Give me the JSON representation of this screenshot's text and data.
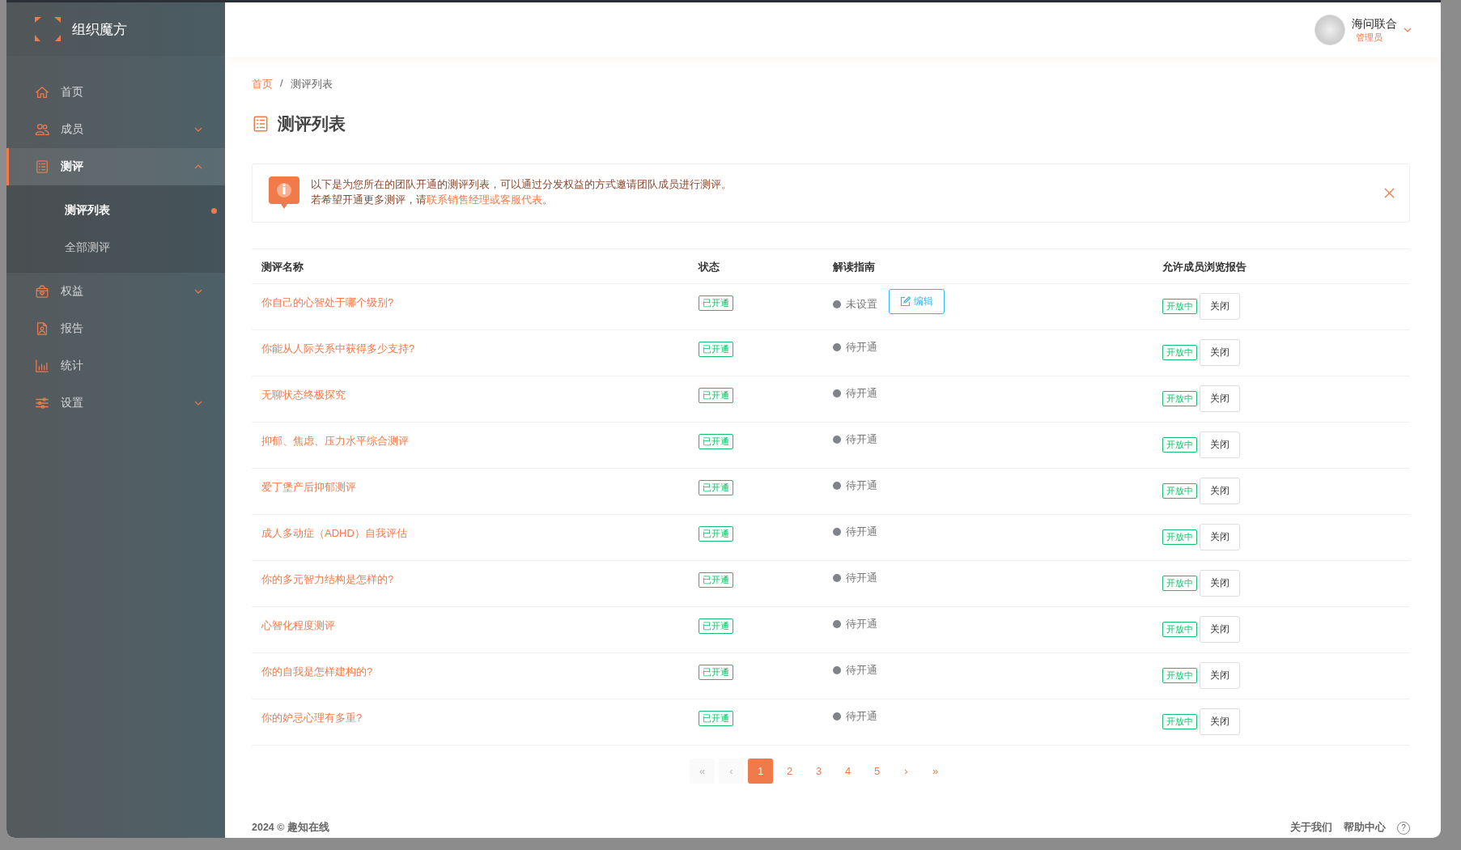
{
  "sidebar": {
    "logo_text": "组织魔方",
    "items": [
      {
        "label": "首页",
        "kind": "link",
        "selected": false
      },
      {
        "label": "成员",
        "kind": "group",
        "selected": false,
        "expanded": false
      },
      {
        "label": "测评",
        "kind": "group",
        "selected": true,
        "expanded": true,
        "children": [
          {
            "label": "测评列表",
            "selected": true
          },
          {
            "label": "全部测评",
            "selected": false
          }
        ]
      },
      {
        "label": "权益",
        "kind": "group",
        "selected": false,
        "expanded": false
      },
      {
        "label": "报告",
        "kind": "link",
        "selected": false
      },
      {
        "label": "统计",
        "kind": "link",
        "selected": false
      },
      {
        "label": "设置",
        "kind": "group",
        "selected": false,
        "expanded": false
      }
    ]
  },
  "header": {
    "user_name": "海问联合",
    "role": "管理员"
  },
  "breadcrumb": [
    {
      "label": "首页",
      "kind": "link"
    },
    {
      "label": "/",
      "kind": "separator"
    },
    {
      "label": "测评列表",
      "kind": "current"
    }
  ],
  "page_title": "测评列表",
  "alert": {
    "lines": [
      "以下是为您所在的团队开通的测评列表，可以通过分发权益的方式邀请团队成员进行测评。",
      "若希望开通更多测评，请**联系销售经理或客服代表**。"
    ]
  },
  "table": {
    "columns": [
      "测评名称",
      "状态",
      "解读指南",
      "允许成员浏览报告"
    ],
    "rows": [
      {
        "name": "你自己的心智处于哪个级别?",
        "status": "已开通",
        "guide": "未设置",
        "guide_button": "编辑",
        "report_tag": "开放中",
        "report_button": "关闭"
      },
      {
        "name": "你能从人际关系中获得多少支持?",
        "status": "已开通",
        "guide": "待开通",
        "report_tag": "开放中",
        "report_button": "关闭"
      },
      {
        "name": "无聊状态终极探究",
        "status": "已开通",
        "guide": "待开通",
        "report_tag": "开放中",
        "report_button": "关闭"
      },
      {
        "name": "抑郁、焦虑、压力水平综合测评",
        "status": "已开通",
        "guide": "待开通",
        "report_tag": "开放中",
        "report_button": "关闭"
      },
      {
        "name": "爱丁堡产后抑郁测评",
        "status": "已开通",
        "guide": "待开通",
        "report_tag": "开放中",
        "report_button": "关闭"
      },
      {
        "name": "成人多动症（ADHD）自我评估",
        "status": "已开通",
        "guide": "待开通",
        "report_tag": "开放中",
        "report_button": "关闭"
      },
      {
        "name": "你的多元智力结构是怎样的?",
        "status": "已开通",
        "guide": "待开通",
        "report_tag": "开放中",
        "report_button": "关闭"
      },
      {
        "name": "心智化程度测评",
        "status": "已开通",
        "guide": "待开通",
        "report_tag": "开放中",
        "report_button": "关闭"
      },
      {
        "name": "你的自我是怎样建构的?",
        "status": "已开通",
        "guide": "待开通",
        "report_tag": "开放中",
        "report_button": "关闭"
      },
      {
        "name": "你的妒忌心理有多重?",
        "status": "已开通",
        "guide": "待开通",
        "report_tag": "开放中",
        "report_button": "关闭"
      }
    ]
  },
  "pagination": [
    {
      "label": "«",
      "kind": "nav",
      "selected": false
    },
    {
      "label": "‹",
      "kind": "nav",
      "selected": false
    },
    {
      "label": "1",
      "kind": "page",
      "selected": true
    },
    {
      "label": "2",
      "kind": "page",
      "selected": false
    },
    {
      "label": "3",
      "kind": "page",
      "selected": false
    },
    {
      "label": "4",
      "kind": "page",
      "selected": false
    },
    {
      "label": "5",
      "kind": "page",
      "selected": false
    },
    {
      "label": "›",
      "kind": "next",
      "selected": false
    },
    {
      "label": "»",
      "kind": "next",
      "selected": false
    }
  ],
  "footer": {
    "copyright": "2024 © 趣知在线",
    "links": [
      "关于我们",
      "帮助中心"
    ],
    "help": "?"
  }
}
